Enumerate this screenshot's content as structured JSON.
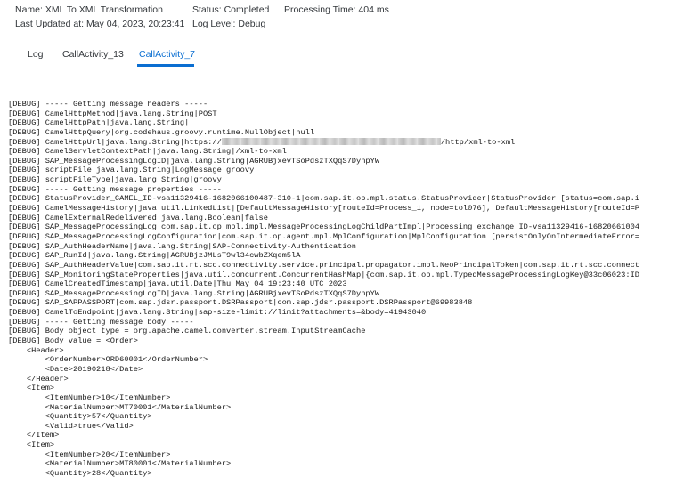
{
  "meta": {
    "name": "Name: XML To XML Transformation",
    "status": "Status: Completed",
    "processing_time": "Processing Time: 404 ms",
    "last_updated": "Last Updated at: May 04, 2023, 20:23:41",
    "log_level": "Log Level: Debug"
  },
  "tabs": [
    {
      "label": "Log",
      "active": false
    },
    {
      "label": "CallActivity_13",
      "active": false
    },
    {
      "label": "CallActivity_7",
      "active": true
    }
  ],
  "colors": {
    "accent": "#0a6ed1",
    "text": "#32363a"
  },
  "log": {
    "lines": [
      "[DEBUG] ----- Getting message headers -----",
      "[DEBUG] CamelHttpMethod|java.lang.String|POST",
      "[DEBUG] CamelHttpPath|java.lang.String|",
      "[DEBUG] CamelHttpQuery|org.codehaus.groovy.runtime.NullObject|null",
      "[DEBUG] CamelHttpUrl|java.lang.String|https://",
      "[DEBUG] CamelServletContextPath|java.lang.String|/xml-to-xml",
      "[DEBUG] SAP_MessageProcessingLogID|java.lang.String|AGRUBjxevTSoPdszTXQqS7DynpYW",
      "[DEBUG] scriptFile|java.lang.String|LogMessage.groovy",
      "[DEBUG] scriptFileType|java.lang.String|groovy",
      "[DEBUG] ----- Getting message properties -----",
      "[DEBUG] StatusProvider_CAMEL_ID-vsa11329416-1682066100487-310-1|com.sap.it.op.mpl.status.StatusProvider|StatusProvider [status=com.sap.i",
      "[DEBUG] CamelMessageHistory|java.util.LinkedList|[DefaultMessageHistory[routeId=Process_1, node=tol076], DefaultMessageHistory[routeId=P",
      "[DEBUG] CamelExternalRedelivered|java.lang.Boolean|false",
      "[DEBUG] SAP_MessageProcessingLog|com.sap.it.op.mpl.impl.MessageProcessingLogChildPartImpl|Processing exchange ID-vsa11329416-16820661004",
      "[DEBUG] SAP_MessageProcessingLogConfiguration|com.sap.it.op.agent.mpl.MplConfiguration|MplConfiguration [persistOnlyOnIntermediateError=",
      "[DEBUG] SAP_AuthHeaderName|java.lang.String|SAP-Connectivity-Authentication",
      "[DEBUG] SAP_RunId|java.lang.String|AGRUBjzJMLsT9wl34cwbZXqem5lA",
      "[DEBUG] SAP_AuthHeaderValue|com.sap.it.rt.scc.connectivity.service.principal.propagator.impl.NeoPrincipalToken|com.sap.it.rt.scc.connect",
      "[DEBUG] SAP_MonitoringStateProperties|java.util.concurrent.ConcurrentHashMap|{com.sap.it.op.mpl.TypedMessageProcessingLogKey@33c06023:ID",
      "[DEBUG] CamelCreatedTimestamp|java.util.Date|Thu May 04 19:23:40 UTC 2023",
      "[DEBUG] SAP_MessageProcessingLogID|java.lang.String|AGRUBjxevTSoPdszTXQqS7DynpYW",
      "[DEBUG] SAP_SAPPASSPORT|com.sap.jdsr.passport.DSRPassport|com.sap.jdsr.passport.DSRPassport@69983848",
      "[DEBUG] CamelToEndpoint|java.lang.String|sap-size-limit://limit?attachments=&body=41943040",
      "[DEBUG] ----- Getting message body -----",
      "[DEBUG] Body object type = org.apache.camel.converter.stream.InputStreamCache",
      "[DEBUG] Body value = <Order>",
      "    <Header>",
      "        <OrderNumber>ORD60001</OrderNumber>",
      "        <Date>20190218</Date>",
      "    </Header>",
      "    <Item>",
      "        <ItemNumber>10</ItemNumber>",
      "        <MaterialNumber>MT70001</MaterialNumber>",
      "        <Quantity>57</Quantity>",
      "        <Valid>true</Valid>",
      "    </Item>",
      "    <Item>",
      "        <ItemNumber>20</ItemNumber>",
      "        <MaterialNumber>MT80001</MaterialNumber>",
      "        <Quantity>28</Quantity>"
    ],
    "url_suffix": "/http/xml-to-xml"
  }
}
